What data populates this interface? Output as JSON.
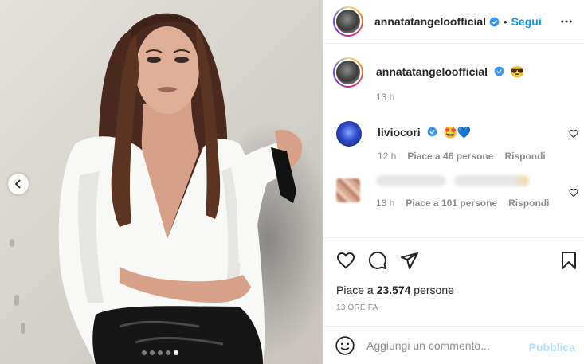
{
  "post": {
    "author": "annatatangeloofficial",
    "separator": "•",
    "follow_label": "Segui",
    "carousel_total": 5,
    "carousel_active": 5
  },
  "caption": {
    "author": "annatatangeloofficial",
    "emoji": "😎",
    "time": "13 h"
  },
  "comments": [
    {
      "author": "liviocori",
      "emoji": "🤩💙",
      "time": "12 h",
      "likes": "Piace a 46 persone",
      "reply": "Rispondi"
    },
    {
      "author": "",
      "time": "13 h",
      "likes": "Piace a 101 persone",
      "reply": "Rispondi"
    }
  ],
  "likes": {
    "prefix": "Piace a ",
    "count": "23.574",
    "suffix": " persone"
  },
  "ago": "13 ORE FA",
  "add_comment": {
    "placeholder": "Aggiungi un commento...",
    "publish_label": "Pubblica"
  },
  "colors": {
    "accent": "#0095f6",
    "publish_disabled": "#b2dffc",
    "verified": "#3897f0",
    "border": "#efefef",
    "muted": "#8e8e8e"
  },
  "icons": [
    "verified-badge-icon",
    "more-options-icon",
    "heart-icon",
    "comment-icon",
    "share-icon",
    "bookmark-icon",
    "emoji-icon",
    "chevron-left-icon"
  ]
}
